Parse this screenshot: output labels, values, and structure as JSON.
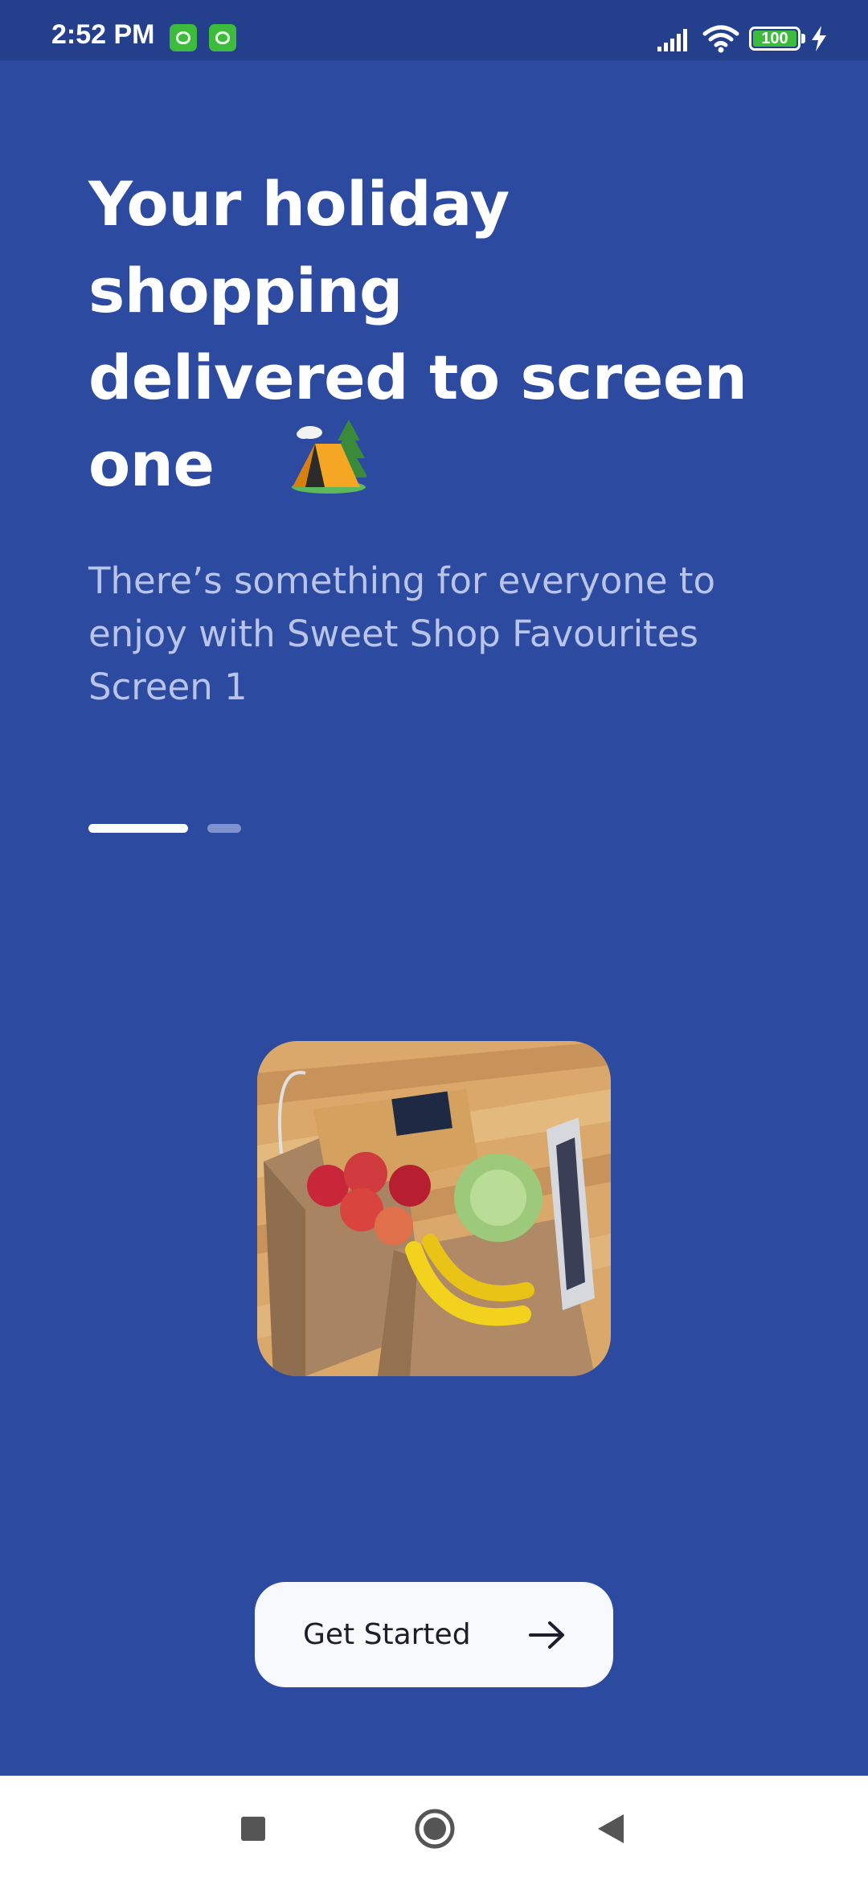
{
  "status_bar": {
    "time": "2:52 PM",
    "battery_level": "100",
    "notification_icons": [
      "app-notification-icon",
      "app-notification-icon"
    ],
    "icons": [
      "signal-icon",
      "wifi-icon",
      "battery-icon",
      "charging-icon"
    ]
  },
  "onboarding": {
    "headline_lines": [
      "Your holiday",
      "shopping",
      "delivered to screen",
      "one"
    ],
    "headline_emoji": "camping-tent-emoji",
    "subtitle_lines": [
      "There’s something for everyone to",
      "enjoy with Sweet Shop Favourites",
      "Screen 1"
    ],
    "pager": {
      "page_count": 2,
      "current_page": 1
    },
    "image": "grocery-bags-photo"
  },
  "cta": {
    "label": "Get Started",
    "icon": "arrow-right-icon"
  },
  "nav_bar": {
    "icons": [
      "recent-apps-icon",
      "home-icon",
      "back-icon"
    ]
  },
  "colors": {
    "background": "#2c4aa0",
    "status_bar": "#243f8c",
    "headline_text": "#ffffff",
    "subtitle_text": "#b9c4e6",
    "button_background": "#f8f9fc",
    "button_text": "#1d1d2b",
    "pager_active": "#ffffff",
    "pager_inactive": "#7f93cf"
  }
}
